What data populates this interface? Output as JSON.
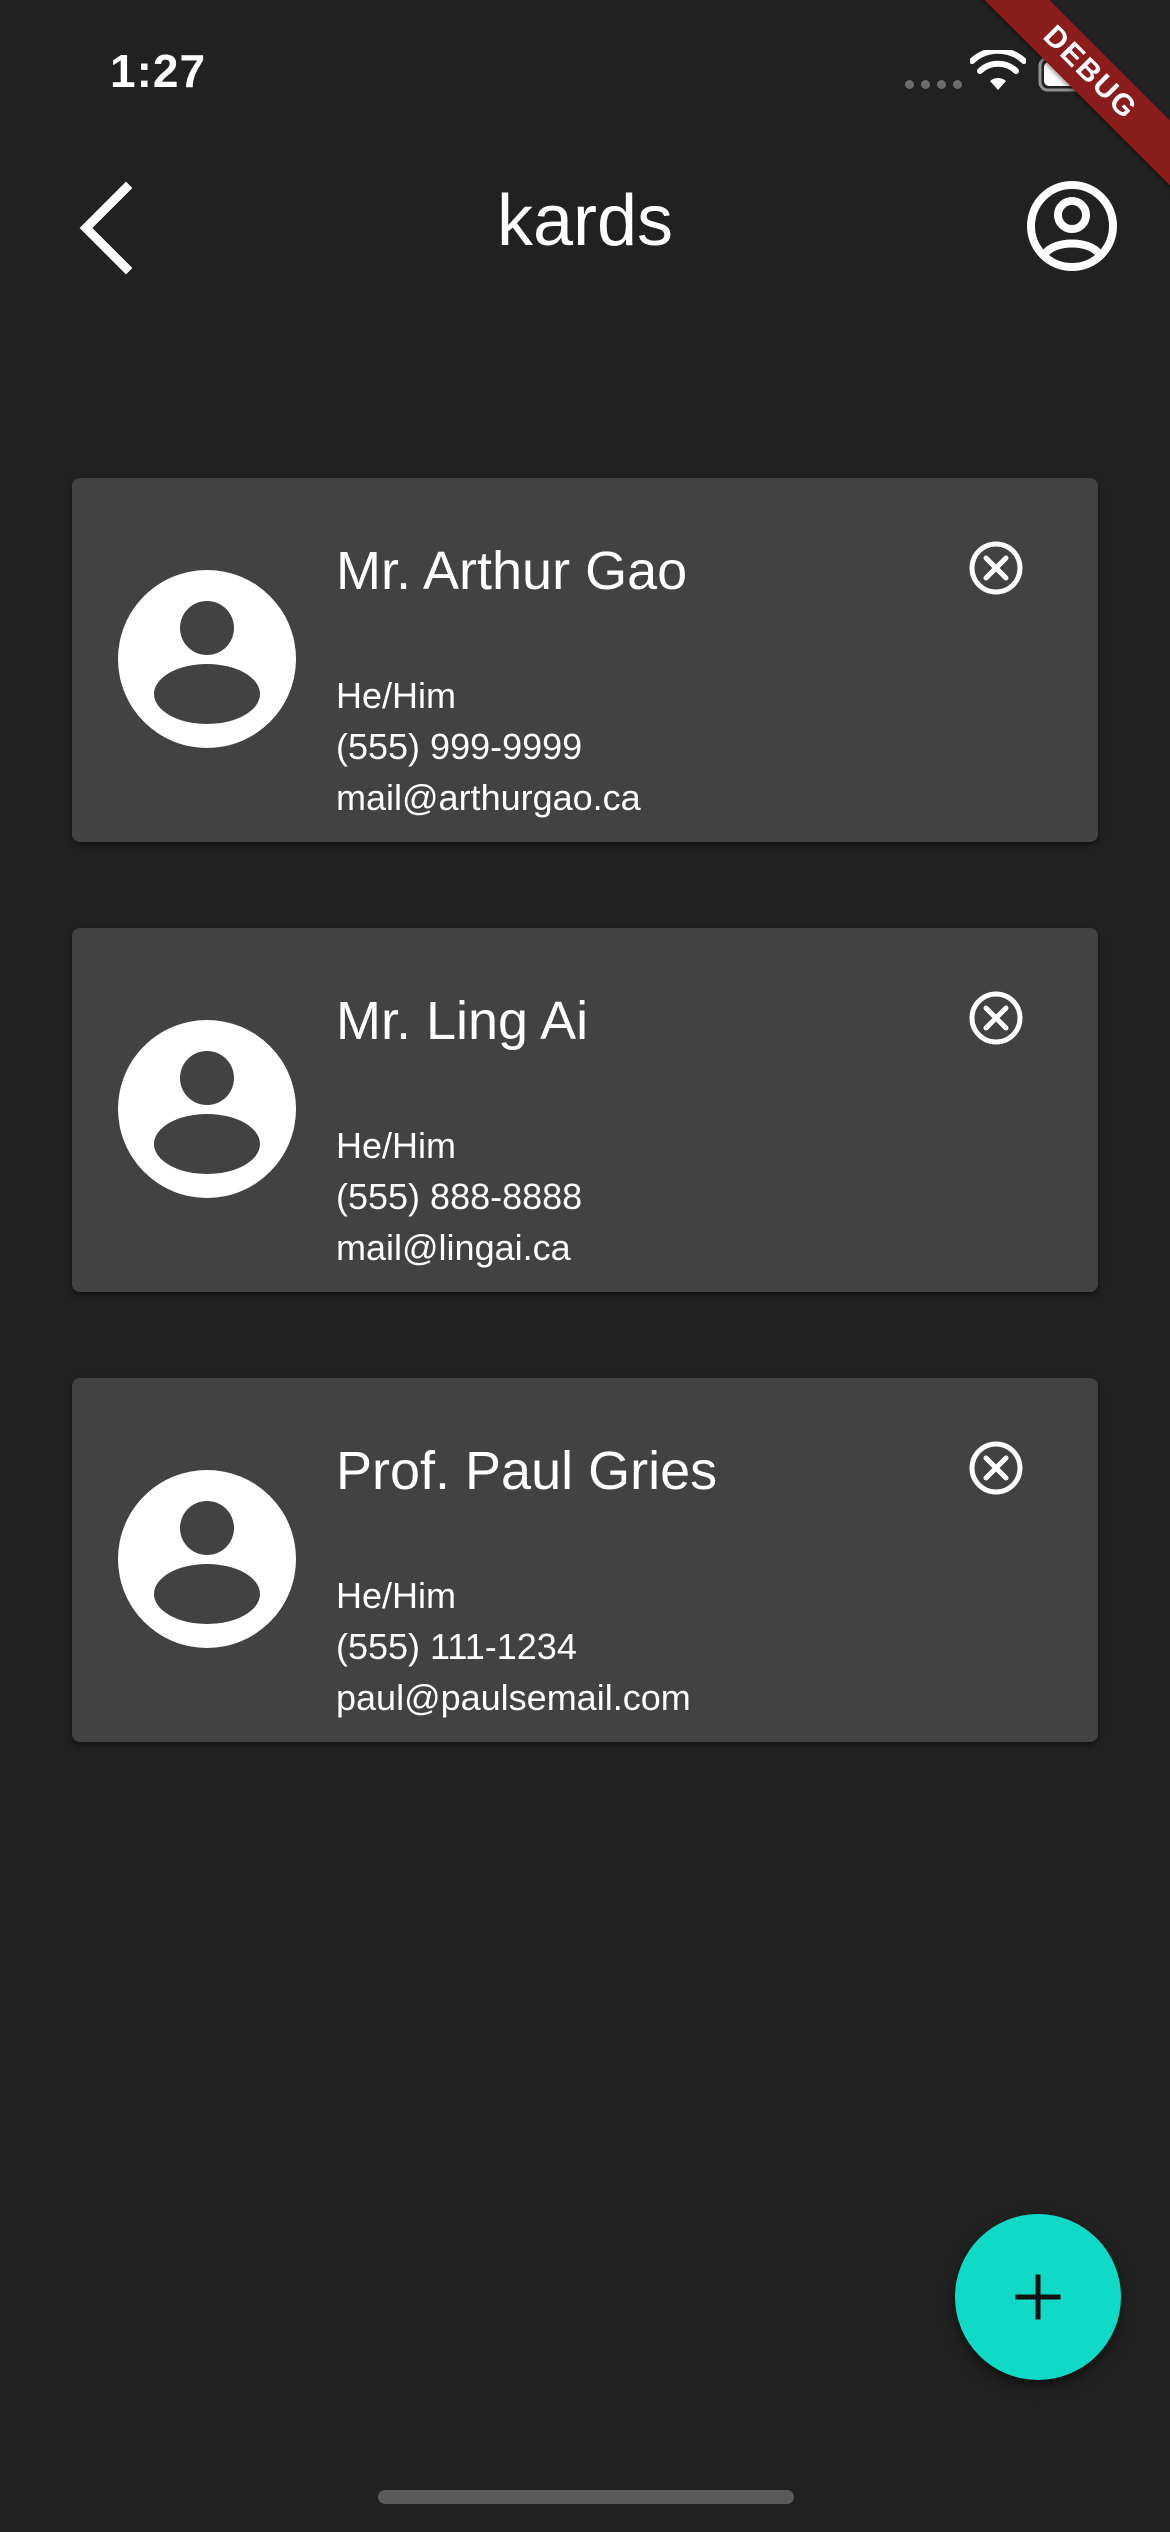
{
  "status_bar": {
    "time": "1:27",
    "icons": [
      "cellular-dots-icon",
      "wifi-icon",
      "battery-icon"
    ]
  },
  "debug_banner": "DEBUG",
  "app_bar": {
    "title": "kards",
    "left_icon": "chevron-back-icon",
    "right_icon": "account-circle-icon"
  },
  "cards": [
    {
      "name": "Mr. Arthur Gao",
      "pronouns": "He/Him",
      "phone": "(555) 999-9999",
      "email": "mail@arthurgao.ca"
    },
    {
      "name": "Mr. Ling Ai",
      "pronouns": "He/Him",
      "phone": "(555) 888-8888",
      "email": "mail@lingai.ca"
    },
    {
      "name": "Prof. Paul Gries",
      "pronouns": "He/Him",
      "phone": "(555) 111-1234",
      "email": "paul@paulsemail.com"
    }
  ],
  "fab": {
    "icon": "plus-icon"
  },
  "colors": {
    "background": "#212121",
    "card": "#424242",
    "accent": "#10d9c5",
    "debug_ribbon": "#8a1c1c"
  }
}
